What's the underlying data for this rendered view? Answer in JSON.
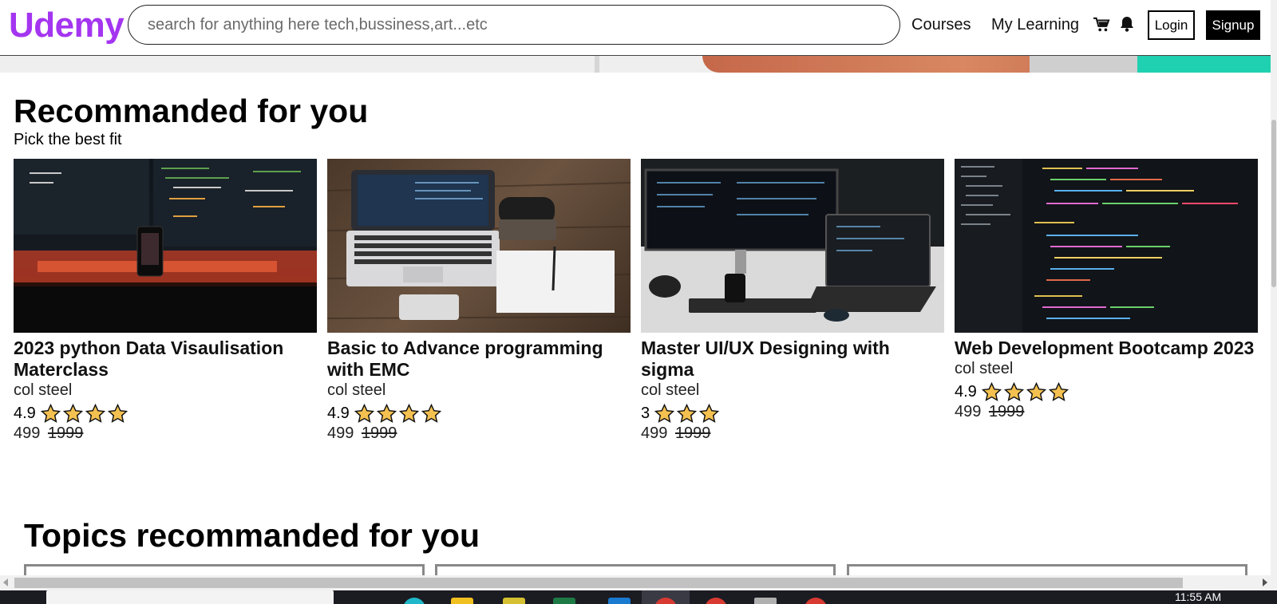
{
  "header": {
    "logo": "Udemy",
    "search_placeholder": "search for anything here tech,bussiness,art...etc",
    "nav": {
      "courses": "Courses",
      "my_learning": "My Learning"
    },
    "login_label": "Login",
    "signup_label": "Signup",
    "icons": {
      "cart": "cart-icon",
      "bell": "bell-icon"
    }
  },
  "recommended": {
    "title": "Recommanded for you",
    "subtitle": "Pick the best fit",
    "cards": [
      {
        "title": "2023 python Data Visaulisation Materclass",
        "author": "col steel",
        "rating": "4.9",
        "stars": 4,
        "price": "499",
        "old_price": "1999"
      },
      {
        "title": "Basic to Advance programming with EMC",
        "author": "col steel",
        "rating": "4.9",
        "stars": 4,
        "price": "499",
        "old_price": "1999"
      },
      {
        "title": "Master UI/UX Designing with sigma",
        "author": "col steel",
        "rating": "3",
        "stars": 3,
        "price": "499",
        "old_price": "1999"
      },
      {
        "title": "Web Development Bootcamp 2023",
        "author": "col steel",
        "rating": "4.9",
        "stars": 4,
        "price": "499",
        "old_price": "1999"
      }
    ]
  },
  "topics": {
    "title": "Topics recommanded for you"
  },
  "taskbar": {
    "clock": "11:55 AM"
  },
  "colors": {
    "brand": "#a435f0",
    "star": "#f4c150"
  }
}
